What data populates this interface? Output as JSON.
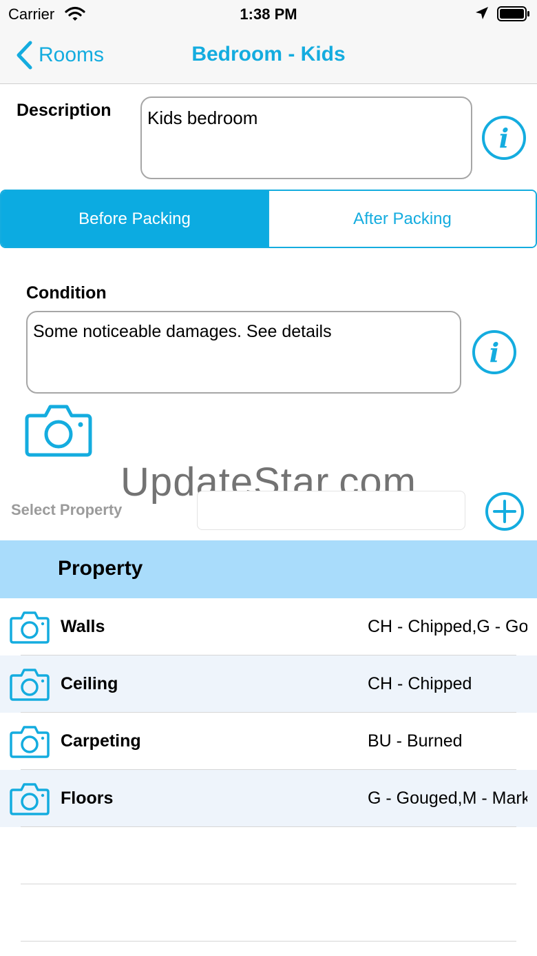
{
  "status_bar": {
    "carrier": "Carrier",
    "time": "1:38 PM"
  },
  "nav": {
    "back_label": "Rooms",
    "title": "Bedroom - Kids"
  },
  "description": {
    "label": "Description",
    "value": "Kids bedroom"
  },
  "segments": {
    "before": "Before Packing",
    "after": "After Packing",
    "selected": "Before Packing"
  },
  "condition": {
    "label": "Condition",
    "value": "Some noticeable damages. See details"
  },
  "watermark": "UpdateStar.com",
  "select_property": {
    "label": "Select Property",
    "value": ""
  },
  "table": {
    "header": "Property",
    "rows": [
      {
        "name": "Walls",
        "value": "CH - Chipped,G - Gouged"
      },
      {
        "name": "Ceiling",
        "value": "CH - Chipped"
      },
      {
        "name": "Carpeting",
        "value": "BU - Burned"
      },
      {
        "name": "Floors",
        "value": "G - Gouged,M - Marked"
      }
    ]
  },
  "colors": {
    "accent": "#14acdf",
    "header_bg": "#a9dcfb",
    "alt_row_bg": "#eef4fb"
  },
  "icons": [
    "wifi-icon",
    "location-arrow-icon",
    "battery-icon",
    "chevron-left-icon",
    "info-icon",
    "camera-icon",
    "plus-circle-icon"
  ]
}
